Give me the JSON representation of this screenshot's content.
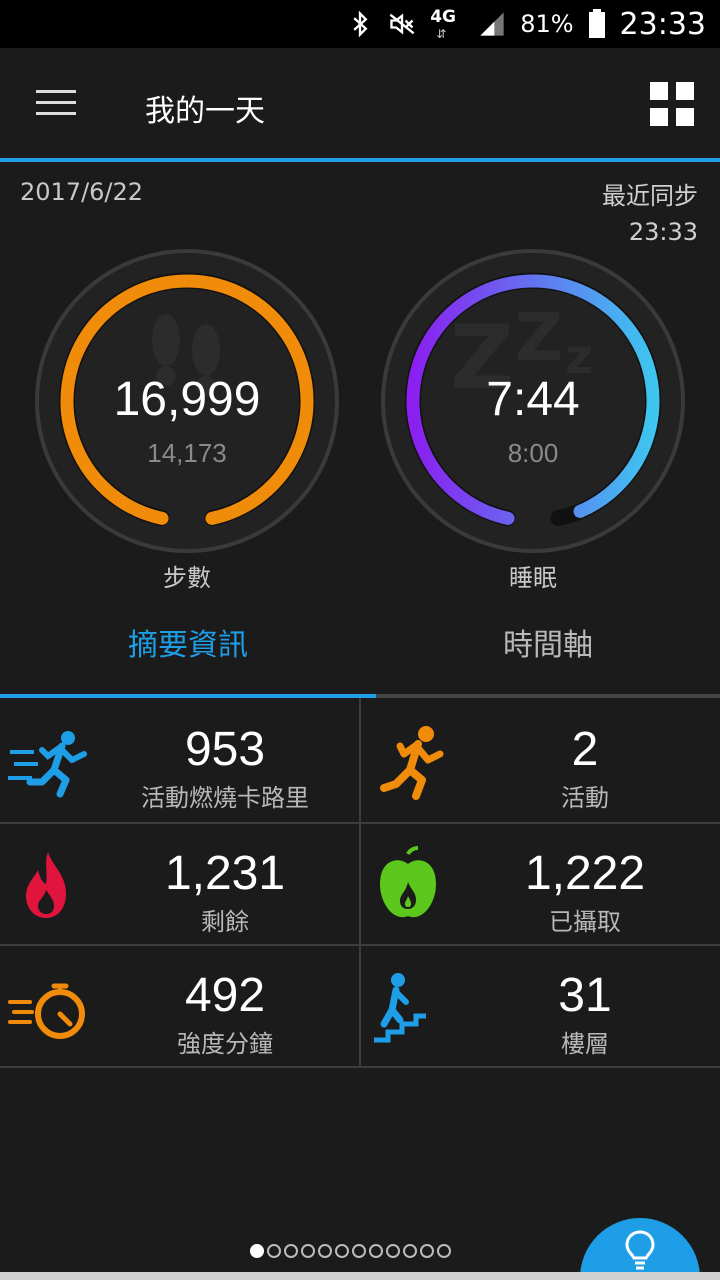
{
  "status_bar": {
    "network": "4G",
    "battery": "81%",
    "time": "23:33"
  },
  "app_bar": {
    "title": "我的一天"
  },
  "header": {
    "date": "2017/6/22",
    "sync_label": "最近同步",
    "sync_time": "23:33"
  },
  "rings": {
    "steps": {
      "value": "16,999",
      "goal": "14,173",
      "label": "步數",
      "progress": 1.0,
      "color": "#f08c0a"
    },
    "sleep": {
      "value": "7:44",
      "goal": "8:00",
      "label": "睡眠",
      "progress": 0.967,
      "color_start": "#8a1ff0",
      "color_end": "#3ec6f0"
    }
  },
  "tabs": [
    {
      "label": "摘要資訊",
      "active": true
    },
    {
      "label": "時間軸",
      "active": false
    }
  ],
  "stats": [
    {
      "value": "953",
      "label": "活動燃燒卡路里",
      "icon": "running-fast-icon",
      "color": "#1e9ee6"
    },
    {
      "value": "2",
      "label": "活動",
      "icon": "running-person-icon",
      "color": "#f08c0a"
    },
    {
      "value": "1,231",
      "label": "剩餘",
      "icon": "flame-icon",
      "color": "#e0143c"
    },
    {
      "value": "1,222",
      "label": "已攝取",
      "icon": "apple-icon",
      "color": "#5cc81e"
    },
    {
      "value": "492",
      "label": "強度分鐘",
      "icon": "stopwatch-icon",
      "color": "#f08c0a"
    },
    {
      "value": "31",
      "label": "樓層",
      "icon": "stairs-icon",
      "color": "#1e9ee6"
    }
  ],
  "pager": {
    "count": 12,
    "current": 1
  },
  "fab": {
    "icon": "lightbulb-icon"
  }
}
